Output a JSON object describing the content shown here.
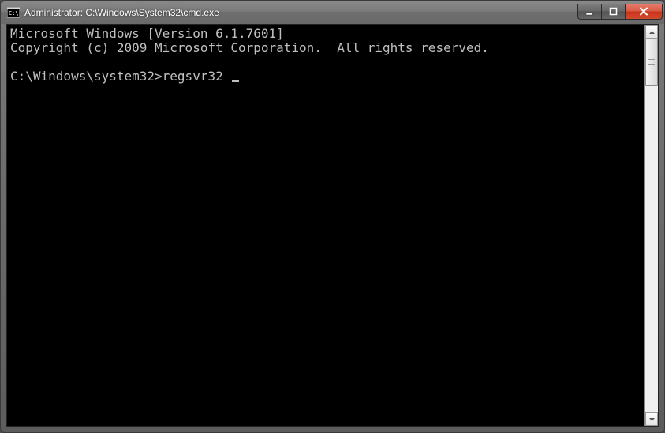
{
  "window": {
    "title": "Administrator: C:\\Windows\\System32\\cmd.exe"
  },
  "terminal": {
    "line1": "Microsoft Windows [Version 6.1.7601]",
    "line2": "Copyright (c) 2009 Microsoft Corporation.  All rights reserved.",
    "blank": "",
    "prompt": "C:\\Windows\\system32>",
    "command": "regsvr32 "
  }
}
